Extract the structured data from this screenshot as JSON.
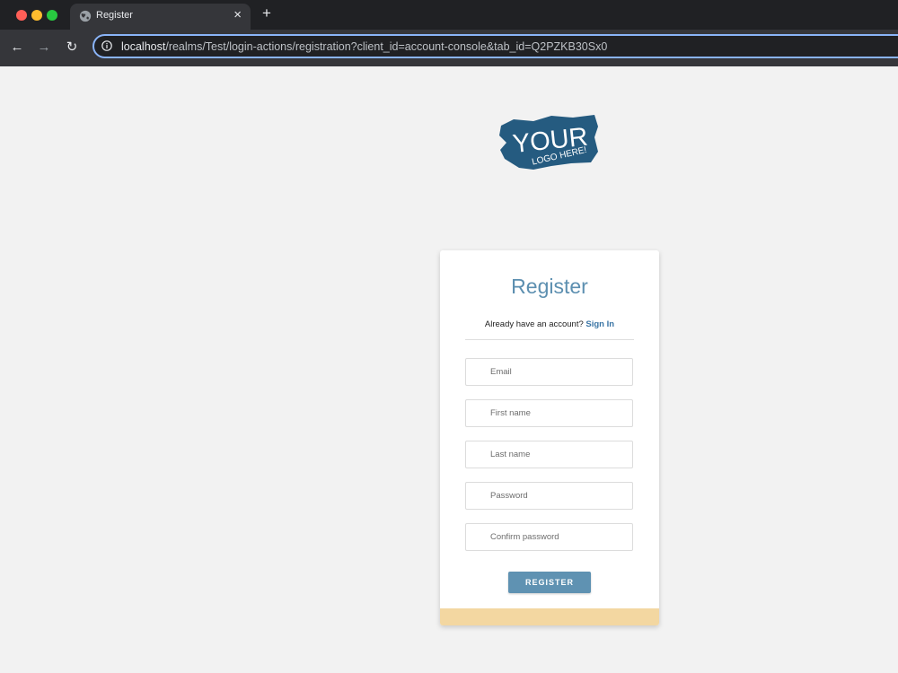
{
  "browser": {
    "tab_title": "Register",
    "tab_close": "×",
    "new_tab": "+",
    "back": "←",
    "forward": "→",
    "reload": "↻",
    "url_host": "localhost",
    "url_path": "/realms/Test/login-actions/registration?client_id=account-console&tab_id=Q2PZKB30Sx0"
  },
  "logo": {
    "line1": "YOUR",
    "line2": "LOGO HERE!"
  },
  "form": {
    "title": "Register",
    "already_text": "Already have an account?",
    "signin_link": "Sign In",
    "fields": {
      "email_placeholder": "Email",
      "first_name_placeholder": "First name",
      "last_name_placeholder": "Last name",
      "password_placeholder": "Password",
      "confirm_password_placeholder": "Confirm password"
    },
    "submit_label": "REGISTER"
  },
  "colors": {
    "accent": "#5f92b2",
    "title": "#5c8fb0",
    "footer": "#f3d7a1",
    "logo": "#255b80"
  }
}
